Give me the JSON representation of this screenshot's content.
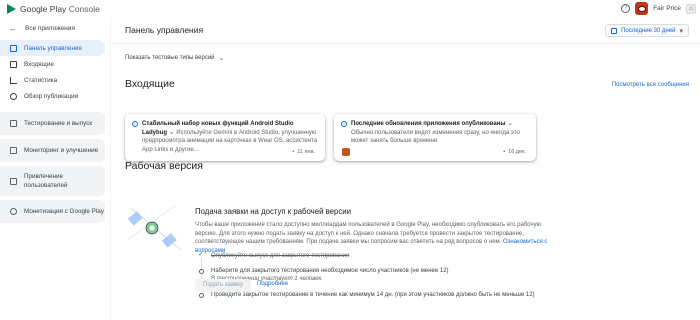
{
  "header": {
    "logo_text_1": "Google Play",
    "logo_text_2": "Console",
    "help_icon": "help-icon",
    "account_name": "Fair Price"
  },
  "sidebar": {
    "back_label": "Все приложения",
    "items": [
      {
        "label": "Панель управления",
        "icon": "dashboard-icon",
        "active": true
      },
      {
        "label": "Входящие",
        "icon": "inbox-icon"
      },
      {
        "label": "Статистика",
        "icon": "stats-icon"
      },
      {
        "label": "Обзор публикации",
        "icon": "publishing-icon"
      }
    ],
    "groups": [
      {
        "label": "Тестирование и выпуск"
      },
      {
        "label": "Мониторинг и улучшение"
      },
      {
        "label_1": "Привлечение",
        "label_2": "пользователей"
      },
      {
        "label": "Монетизация с Google Play"
      }
    ]
  },
  "main": {
    "title": "Панель управления",
    "date_range": "Последние 30 дней",
    "test_toggle": "Показать тестовые типы версий",
    "inbox_title": "Входящие",
    "view_all": "Посмотреть все сообщения",
    "cards": [
      {
        "title": "Стабильный набор новых функций Android Studio Ladybug",
        "body": "Используйте Gemini в Android Studio, улучшенную предпросмотра анимации на карточках в Wear OS, ассистента App Links и другие...",
        "date": "11 янв."
      },
      {
        "title": "Последние обновления приложения опубликованы",
        "body": "Обычно пользователи видят изменения сразу, но иногда это может занять больше времени",
        "date": "16 дек."
      }
    ],
    "prod_title": "Рабочая версия",
    "prod_box": {
      "title": "Подача заявки на доступ к рабочей версии",
      "desc": "Чтобы ваше приложение стало доступно миллиардам пользователей в Google Play, необходимо опубликовать его рабочую версию. Для этого нужно подать заявку на доступ к ней. Однако сначала требуется провести закрытое тестирование, соответствующее нашим требованиям. При подаче заявки мы попросим вас ответить на ряд вопросов о нем.",
      "desc_link": "Ознакомиться с вопросами",
      "steps": [
        {
          "text": "Опубликуйте выпуск для закрытого тестирования",
          "done": true
        },
        {
          "text": "Наберите для закрытого тестирования необходимое число участников (не менее 12)",
          "sub": "В тестировании участвует 1 человек."
        },
        {
          "text": "Проведите закрытое тестирование в течение как минимум 14 дн. (при этом участников должно быть не меньше 12)"
        }
      ],
      "apply_button": "Подать заявку",
      "more_link": "Подробнее"
    }
  },
  "colors": {
    "accent": "#1967d2",
    "brand_green": "#01875f",
    "active_bg": "#e8f0fe"
  }
}
